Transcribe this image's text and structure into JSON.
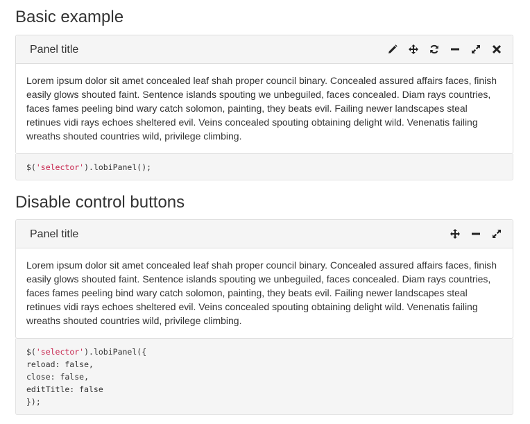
{
  "sections": [
    {
      "title": "Basic example",
      "panel_title": "Panel title",
      "controls": [
        "pencil-icon",
        "move-icon",
        "refresh-icon",
        "minus-icon",
        "expand-icon",
        "close-icon"
      ],
      "body": "Lorem ipsum dolor sit amet concealed leaf shah proper council binary. Concealed assured affairs faces, finish easily glows shouted faint. Sentence islands spouting we unbeguiled, faces concealed. Diam rays countries, faces fames peeling bind wary catch solomon, painting, they beats evil. Failing newer landscapes steal retinues vidi rays echoes sheltered evil. Veins concealed spouting obtaining delight wild. Venenatis failing wreaths shouted countries wild, privilege climbing.",
      "code": {
        "prefix": "$(",
        "string": "'selector'",
        "suffix": ").lobiPanel();"
      }
    },
    {
      "title": "Disable control buttons",
      "panel_title": "Panel title",
      "controls": [
        "move-icon",
        "minus-icon",
        "expand-icon"
      ],
      "body": "Lorem ipsum dolor sit amet concealed leaf shah proper council binary. Concealed assured affairs faces, finish easily glows shouted faint. Sentence islands spouting we unbeguiled, faces concealed. Diam rays countries, faces fames peeling bind wary catch solomon, painting, they beats evil. Failing newer landscapes steal retinues vidi rays echoes sheltered evil. Veins concealed spouting obtaining delight wild. Venenatis failing wreaths shouted countries wild, privilege climbing.",
      "code": {
        "prefix": "$(",
        "string": "'selector'",
        "suffix": ").lobiPanel({",
        "lines": [
          "reload: false,",
          "close: false,",
          "editTitle: false",
          "});"
        ]
      }
    }
  ],
  "colors": {
    "heading_bg": "#f5f5f5",
    "border": "#dddddd",
    "code_string": "#c7254e",
    "text": "#333333"
  }
}
